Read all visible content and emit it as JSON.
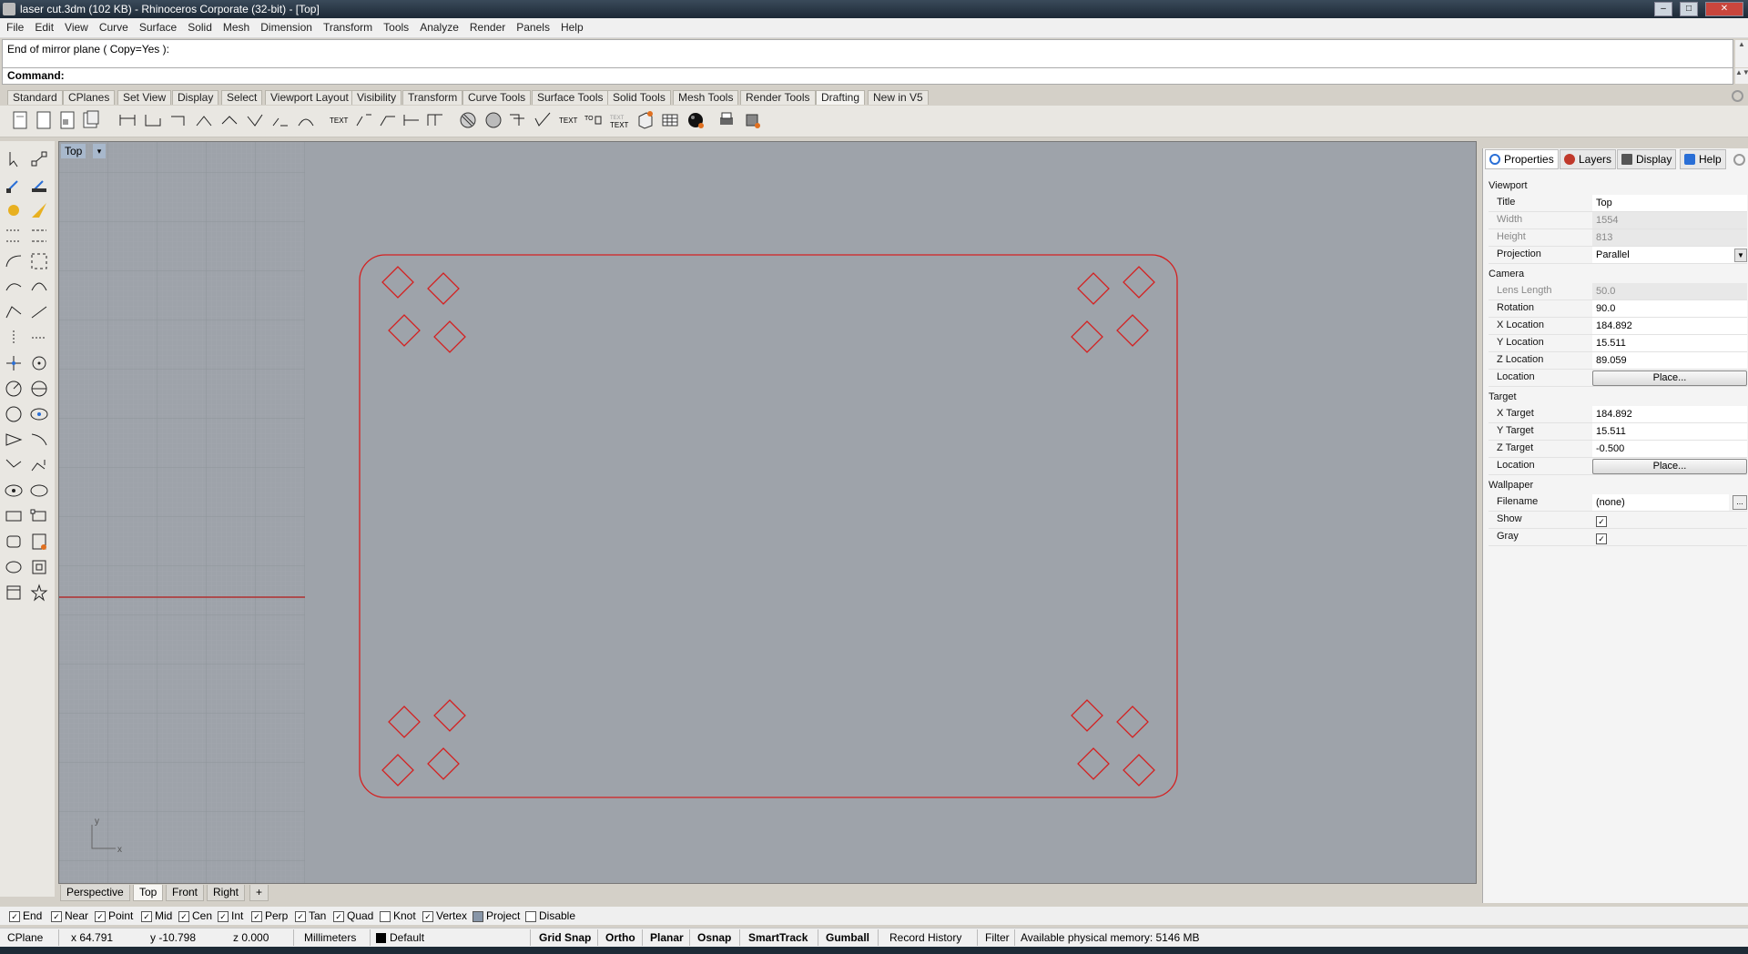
{
  "window": {
    "title": "laser cut.3dm (102 KB) - Rhinoceros Corporate (32-bit) - [Top]",
    "min": "–",
    "max": "□",
    "close": "✕"
  },
  "menu": [
    "File",
    "Edit",
    "View",
    "Curve",
    "Surface",
    "Solid",
    "Mesh",
    "Dimension",
    "Transform",
    "Tools",
    "Analyze",
    "Render",
    "Panels",
    "Help"
  ],
  "command": {
    "history": "End of mirror plane ( Copy=Yes ):",
    "prompt": "Command:"
  },
  "toolbar_tabs": [
    "Standard",
    "CPlanes",
    "Set View",
    "Display",
    "Select",
    "Viewport Layout",
    "Visibility",
    "Transform",
    "Curve Tools",
    "Surface Tools",
    "Solid Tools",
    "Mesh Tools",
    "Render Tools",
    "Drafting",
    "New in V5"
  ],
  "active_toolbar_tab": "Drafting",
  "viewport": {
    "title": "Top",
    "arrow": "▾",
    "axis_x": "x",
    "axis_y": "y"
  },
  "view_tabs": [
    "Perspective",
    "Top",
    "Front",
    "Right"
  ],
  "view_tab_add": "+",
  "active_view": "Top",
  "panel_tabs": [
    {
      "label": "Properties",
      "icon": "properties-icon",
      "color": "#2a6fd6"
    },
    {
      "label": "Layers",
      "icon": "layers-icon",
      "color": "#c0392b"
    },
    {
      "label": "Display",
      "icon": "display-icon",
      "color": "#555555"
    },
    {
      "label": "Help",
      "icon": "help-icon",
      "color": "#2a6fd6"
    }
  ],
  "properties": {
    "viewport_section": "Viewport",
    "title_k": "Title",
    "title_v": "Top",
    "width_k": "Width",
    "width_v": "1554",
    "height_k": "Height",
    "height_v": "813",
    "projection_k": "Projection",
    "projection_v": "Parallel",
    "camera_section": "Camera",
    "lens_k": "Lens Length",
    "lens_v": "50.0",
    "rotation_k": "Rotation",
    "rotation_v": "90.0",
    "xloc_k": "X Location",
    "xloc_v": "184.892",
    "yloc_k": "Y Location",
    "yloc_v": "15.511",
    "zloc_k": "Z Location",
    "zloc_v": "89.059",
    "location_k": "Location",
    "place_btn": "Place...",
    "target_section": "Target",
    "xt_k": "X Target",
    "xt_v": "184.892",
    "yt_k": "Y Target",
    "yt_v": "15.511",
    "zt_k": "Z Target",
    "zt_v": "-0.500",
    "tlocation_k": "Location",
    "tplace_btn": "Place...",
    "wallpaper_section": "Wallpaper",
    "filename_k": "Filename",
    "filename_v": "(none)",
    "browse": "...",
    "show_k": "Show",
    "gray_k": "Gray",
    "check": "✓"
  },
  "osnaps": [
    {
      "label": "End",
      "checked": true
    },
    {
      "label": "Near",
      "checked": true
    },
    {
      "label": "Point",
      "checked": true
    },
    {
      "label": "Mid",
      "checked": true
    },
    {
      "label": "Cen",
      "checked": true
    },
    {
      "label": "Int",
      "checked": true
    },
    {
      "label": "Perp",
      "checked": true
    },
    {
      "label": "Tan",
      "checked": true
    },
    {
      "label": "Quad",
      "checked": true
    },
    {
      "label": "Knot",
      "checked": false
    },
    {
      "label": "Vertex",
      "checked": true
    },
    {
      "label": "Project",
      "checked": false
    },
    {
      "label": "Disable",
      "checked": false
    }
  ],
  "status": {
    "cplane": "CPlane",
    "x": "x 64.791",
    "y": "y -10.798",
    "z": "z 0.000",
    "units": "Millimeters",
    "layer": "Default",
    "layer_color": "#000000",
    "grid_snap": "Grid Snap",
    "ortho": "Ortho",
    "planar": "Planar",
    "osnap": "Osnap",
    "smarttrack": "SmartTrack",
    "gumball": "Gumball",
    "record_history": "Record History",
    "filter": "Filter",
    "memory": "Available physical memory: 5146 MB"
  },
  "colors": {
    "curve": "#d42020",
    "viewport_bg": "#9ea3aa"
  }
}
